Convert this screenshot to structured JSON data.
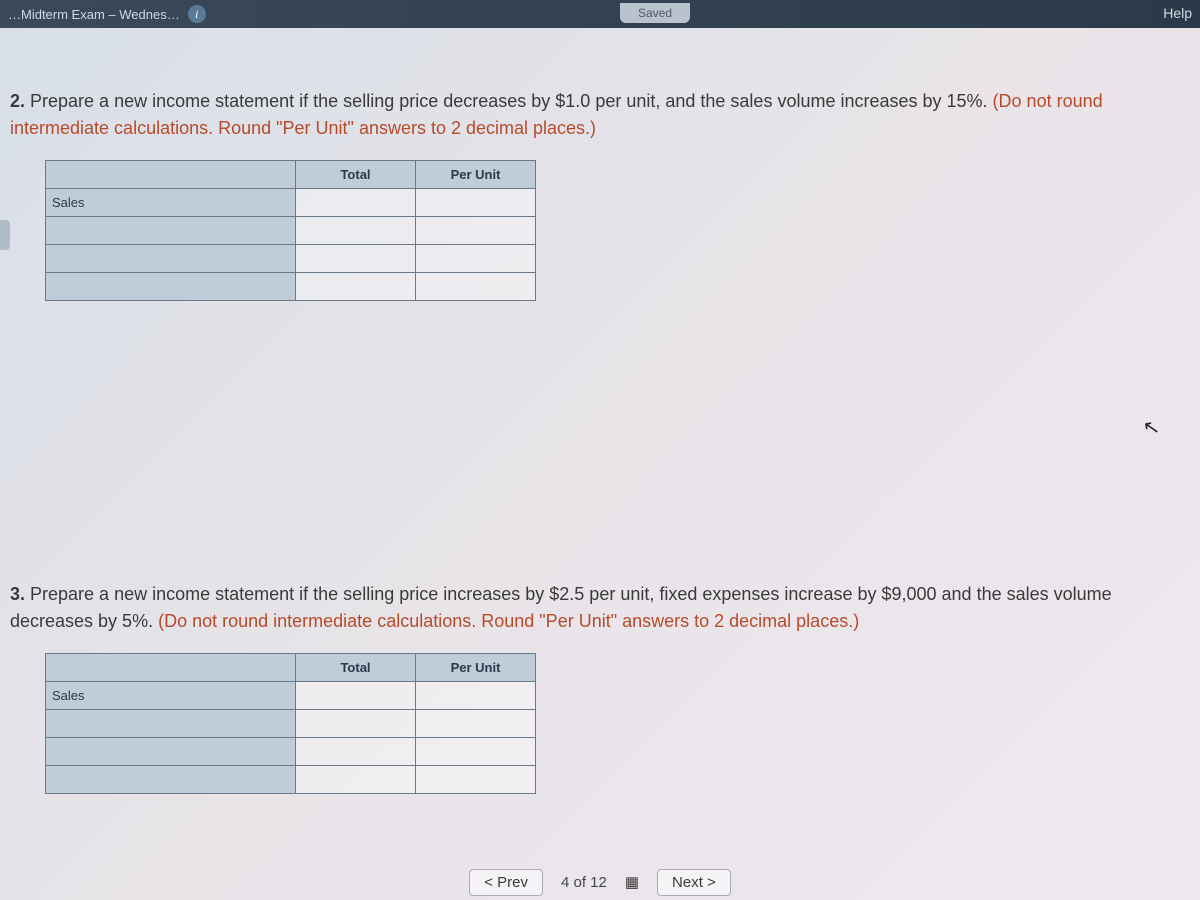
{
  "topbar": {
    "title_fragment": "…Midterm Exam – Wednes…",
    "saved_label": "Saved",
    "help_label": "Help"
  },
  "question2": {
    "number": "2.",
    "text_main": " Prepare a new income statement if the selling price decreases by $1.0 per unit, and the sales volume increases by 15%. ",
    "hint": "(Do not round intermediate calculations. Round \"Per Unit\" answers to 2 decimal places.)",
    "headers": {
      "total": "Total",
      "per_unit": "Per Unit"
    },
    "rows": [
      "Sales",
      "",
      "",
      ""
    ]
  },
  "question3": {
    "number": "3.",
    "text_main": " Prepare a new income statement if the selling price increases by $2.5 per unit, fixed expenses increase by $9,000 and the sales volume decreases by 5%. ",
    "hint": "(Do not round intermediate calculations. Round \"Per Unit\" answers to 2 decimal places.)",
    "headers": {
      "total": "Total",
      "per_unit": "Per Unit"
    },
    "rows": [
      "Sales",
      "",
      "",
      ""
    ]
  },
  "footer": {
    "prev": "< Prev",
    "counter": "4 of 12",
    "next": "Next >"
  }
}
